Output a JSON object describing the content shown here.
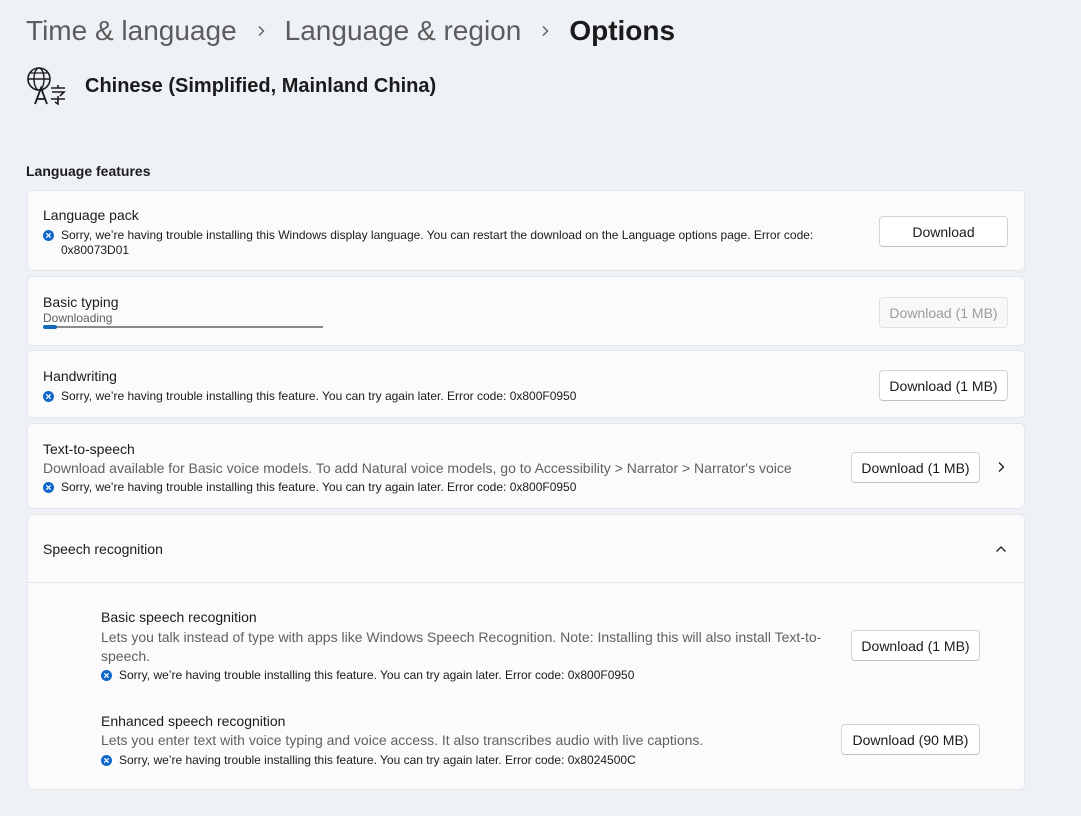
{
  "breadcrumb": {
    "item1": "Time & language",
    "item2": "Language & region",
    "item3": "Options"
  },
  "language": {
    "name": "Chinese (Simplified, Mainland China)",
    "icon": "language-translate-icon"
  },
  "section": "Language features",
  "language_pack": {
    "title": "Language pack",
    "error_line1": "Sorry, we’re having trouble installing this Windows display language. You can restart the download on the Language options page. Error code:",
    "error_line2": "0x80073D01",
    "button": "Download"
  },
  "basic_typing": {
    "title": "Basic typing",
    "status": "Downloading",
    "progress": 0.05,
    "button": "Download (1 MB)"
  },
  "handwriting": {
    "title": "Handwriting",
    "error": "Sorry, we’re having trouble installing this feature. You can try again later. Error code: 0x800F0950",
    "button": "Download (1 MB)"
  },
  "tts": {
    "title": "Text-to-speech",
    "desc": "Download available for Basic voice models. To add Natural voice models, go to Accessibility > Narrator > Narrator's voice",
    "error": "Sorry, we’re having trouble installing this feature. You can try again later. Error code: 0x800F0950",
    "button": "Download (1 MB)"
  },
  "speech": {
    "title": "Speech recognition",
    "basic": {
      "title": "Basic speech recognition",
      "desc_line1": "Lets you talk instead of type with apps like Windows Speech Recognition. Note: Installing this will also install Text-to-",
      "desc_line2": "speech.",
      "error": "Sorry, we’re having trouble installing this feature. You can try again later. Error code: 0x800F0950",
      "button": "Download (1 MB)"
    },
    "enhanced": {
      "title": "Enhanced speech recognition",
      "desc": "Lets you enter text with voice typing and voice access. It also transcribes audio with live captions.",
      "error": "Sorry, we’re having trouble installing this feature. You can try again later. Error code: 0x8024500C",
      "button": "Download (90 MB)"
    }
  },
  "colors": {
    "accent": "#0f6cbd",
    "error_icon": "#1067c9",
    "background": "#eef2f6"
  }
}
